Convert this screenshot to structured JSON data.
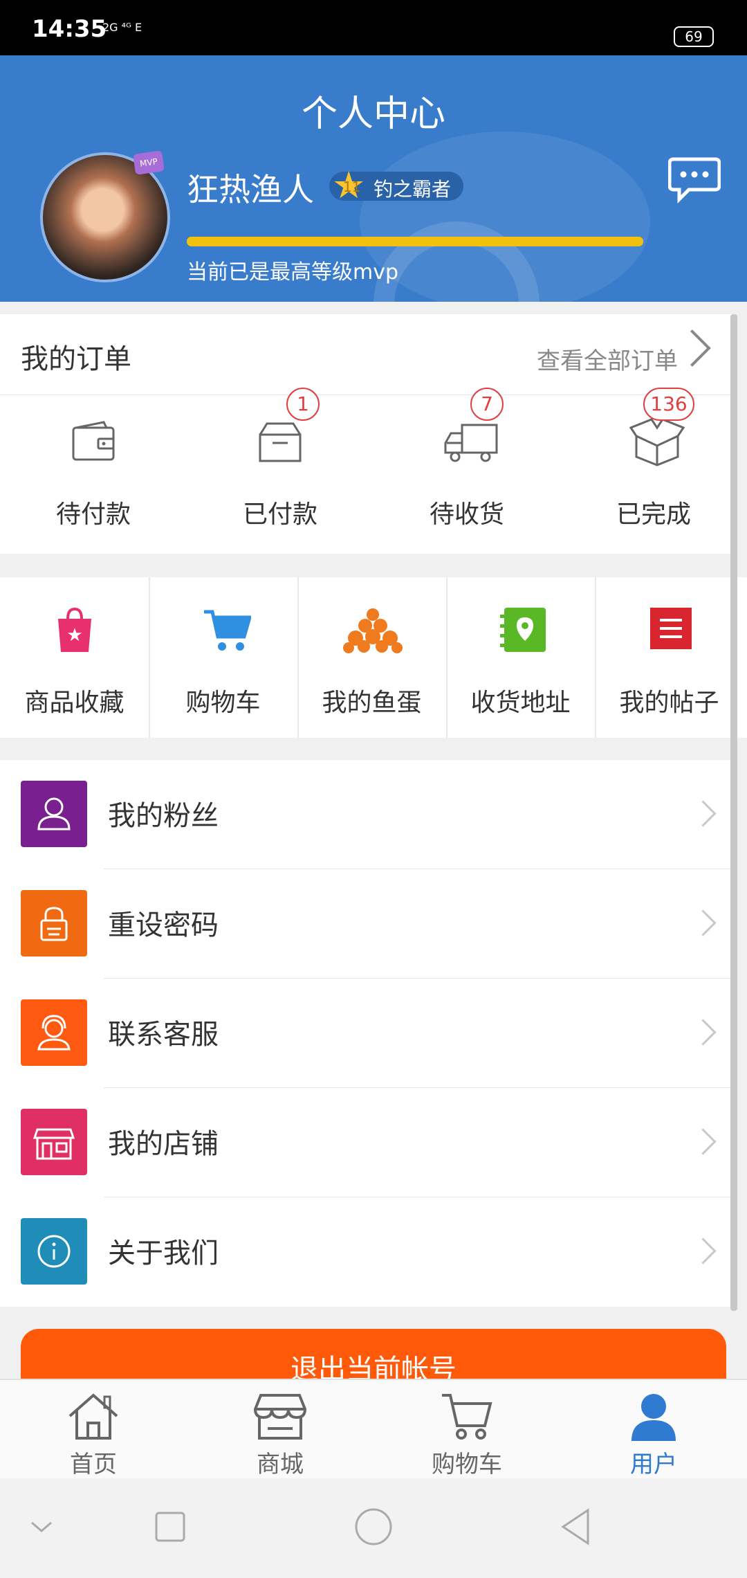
{
  "status_bar": {
    "time": "14:35",
    "network": "2G ⁴ᴳ E",
    "battery": "69"
  },
  "header": {
    "title": "个人中心",
    "avatar_badge": "MVP",
    "username": "狂热渔人",
    "level_number": "11",
    "level_title": "钓之霸者",
    "progress": 1.0,
    "level_description": "当前已是最高等级mvp"
  },
  "orders": {
    "title": "我的订单",
    "view_all": "查看全部订单",
    "items": [
      {
        "label": "待付款",
        "icon": "wallet-icon",
        "badge": ""
      },
      {
        "label": "已付款",
        "icon": "box-icon",
        "badge": "1"
      },
      {
        "label": "待收货",
        "icon": "truck-icon",
        "badge": "7"
      },
      {
        "label": "已完成",
        "icon": "open-box-icon",
        "badge": "136"
      }
    ]
  },
  "shortcuts": [
    {
      "label": "商品收藏",
      "icon": "shopping-bag-star-icon",
      "color": "#e8306e"
    },
    {
      "label": "购物车",
      "icon": "cart-icon",
      "color": "#2f8fe0"
    },
    {
      "label": "我的鱼蛋",
      "icon": "fish-eggs-icon",
      "color": "#f07a1e"
    },
    {
      "label": "收货地址",
      "icon": "address-book-icon",
      "color": "#5ab826"
    },
    {
      "label": "我的帖子",
      "icon": "post-list-icon",
      "color": "#d9252f"
    }
  ],
  "menu": [
    {
      "label": "我的粉丝",
      "icon": "user-icon",
      "color": "#7a1f8f"
    },
    {
      "label": "重设密码",
      "icon": "lock-icon",
      "color": "#ef6a10"
    },
    {
      "label": "联系客服",
      "icon": "support-agent-icon",
      "color": "#ff5a12"
    },
    {
      "label": "我的店铺",
      "icon": "store-icon",
      "color": "#e02f63"
    },
    {
      "label": "关于我们",
      "icon": "info-icon",
      "color": "#1f8db8"
    }
  ],
  "logout_label": "退出当前帐号",
  "tabbar": [
    {
      "label": "首页",
      "icon": "home-icon",
      "active": false
    },
    {
      "label": "商城",
      "icon": "shop-icon",
      "active": false
    },
    {
      "label": "购物车",
      "icon": "cart-outline-icon",
      "active": false
    },
    {
      "label": "用户",
      "icon": "user-filled-icon",
      "active": true
    }
  ],
  "colors": {
    "header_blue": "#3a7ccc",
    "accent_orange": "#ff5a0a",
    "progress_yellow": "#f2c10f",
    "active_tab": "#2e7bd1"
  }
}
